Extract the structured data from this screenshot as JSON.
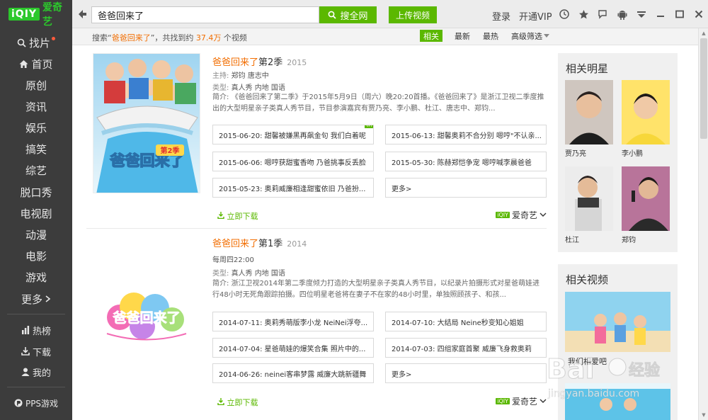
{
  "app": {
    "logo_badge": "iQIY",
    "logo_text": "爱奇艺"
  },
  "search": {
    "query": "爸爸回来了",
    "button": "搜全网",
    "upload": "上传视频"
  },
  "header": {
    "login": "登录",
    "vip": "开通VIP"
  },
  "sidebar": {
    "items": [
      {
        "label": "找片",
        "icon": "search-icon"
      },
      {
        "label": "首页",
        "icon": "home-icon"
      },
      {
        "label": "原创"
      },
      {
        "label": "资讯"
      },
      {
        "label": "娱乐"
      },
      {
        "label": "搞笑"
      },
      {
        "label": "综艺"
      },
      {
        "label": "脱口秀"
      },
      {
        "label": "电视剧"
      },
      {
        "label": "动漫"
      },
      {
        "label": "电影"
      },
      {
        "label": "游戏"
      },
      {
        "label": "更多",
        "icon": "chevron-right-icon"
      }
    ],
    "bottom": [
      {
        "label": "热榜",
        "icon": "chart-icon"
      },
      {
        "label": "下载",
        "icon": "download-icon"
      },
      {
        "label": "我的",
        "icon": "user-icon"
      }
    ],
    "pps": "PPS游戏"
  },
  "filter": {
    "prefix": "搜索“",
    "keyword": "爸爸回来了",
    "middle": "”，共找到约",
    "count": "37.4万",
    "suffix": "个视频",
    "options": [
      "相关",
      "最新",
      "最热",
      "高级筛选"
    ]
  },
  "results": [
    {
      "title_hl": "爸爸回来了",
      "title_rest": "第2季",
      "year": "2015",
      "meta1_label": "主持:",
      "meta1_value": "郑钧 唐志中",
      "meta2_label": "类型:",
      "meta2_value": "真人秀 内地 国语",
      "desc_label": "简介:",
      "desc": "《爸爸回来了第二季》于2015年5月9日（周六）晚20:20首播。《爸爸回来了》是浙江卫视二季度推出的大型明星亲子类真人秀节目，节目参演嘉宾有贾乃亮、李小鹏、杜江、唐志中、郑钧...",
      "episodes": [
        {
          "label": "2015-06-20: 甜馨被嫌黑再飙金句 我们白着呢",
          "badge": "新"
        },
        {
          "label": "2015-06-13: 甜馨奥莉不合分别 嗯哼\"不认亲..."
        },
        {
          "label": "2015-06-06: 嗯哼获甜蜜香吻 乃爸挑事反丢脸"
        },
        {
          "label": "2015-05-30: 陈赫郑恺争宠 嗯哼喊李晨爸爸"
        },
        {
          "label": "2015-05-23: 奥莉威廉相逢甜蜜依旧 乃爸扮..."
        },
        {
          "label": "更多>"
        }
      ],
      "download": "立即下载",
      "source": "爱奇艺"
    },
    {
      "title_hl": "爸爸回来了",
      "title_rest": "第1季",
      "year": "2014",
      "meta1_label": "",
      "meta1_value": "每周四22:00",
      "meta2_label": "类型:",
      "meta2_value": "真人秀 内地 国语",
      "desc_label": "简介:",
      "desc": "浙江卫视2014年第二季度倾力打造的大型明星亲子类真人秀节目，以纪录片拍摄形式对星爸萌娃进行48小时无死角跟踪拍摄。四位明星老爸将在妻子不在家的48小时里，单独照顾孩子、和孩...",
      "episodes": [
        {
          "label": "2014-07-11: 奥莉秀萌版李小龙 NeiNei浮夸..."
        },
        {
          "label": "2014-07-10: 大结局 Neine秒变知心姐姐"
        },
        {
          "label": "2014-07-04: 星爸萌娃的爆笑合集 照片中的..."
        },
        {
          "label": "2014-07-03: 四组家庭首聚 威廉飞身救奥莉"
        },
        {
          "label": "2014-06-26: neinei客串梦露 威廉大跳新疆舞"
        },
        {
          "label": "更多>"
        }
      ],
      "download": "立即下载",
      "source": "爱奇艺"
    }
  ],
  "related_stars": {
    "title": "相关明星",
    "stars": [
      {
        "name": "贾乃亮"
      },
      {
        "name": "李小鹏"
      },
      {
        "name": "杜江"
      },
      {
        "name": "郑钧"
      }
    ]
  },
  "related_videos": {
    "title": "相关视频",
    "first_caption": "我们相爱吧"
  },
  "watermark": {
    "brand": "Bai",
    "brand2": "经验",
    "url": "jingyan.baidu.com"
  },
  "thumb1": {
    "logo": "爸爸回来了",
    "badge": "第2季"
  },
  "thumb2": {
    "logo": "爸爸回来了"
  }
}
